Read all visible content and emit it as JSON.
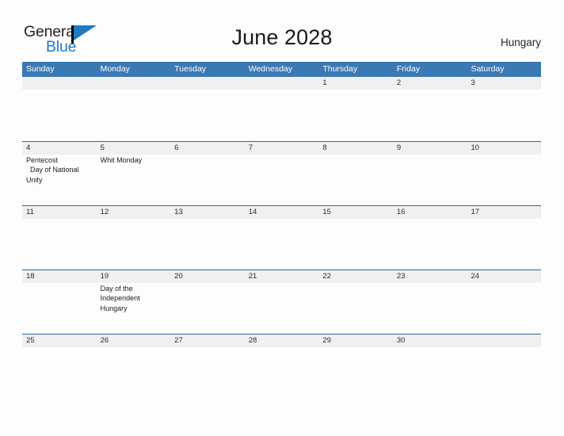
{
  "brand": {
    "word_one": "General",
    "word_two": "Blue",
    "flag_icon": "flag-triangle-icon"
  },
  "header": {
    "title": "June 2028",
    "country": "Hungary"
  },
  "colors": {
    "header_blue": "#3b79b5",
    "row_rule_blue": "#2b6598",
    "number_strip_gray": "#f0f0f0",
    "brand_blue": "#1f7ac4",
    "page_background": "#fdfdfd"
  },
  "calendar": {
    "weekdays": [
      "Sunday",
      "Monday",
      "Tuesday",
      "Wednesday",
      "Thursday",
      "Friday",
      "Saturday"
    ],
    "weeks": [
      [
        {
          "day": "",
          "events": []
        },
        {
          "day": "",
          "events": []
        },
        {
          "day": "",
          "events": []
        },
        {
          "day": "",
          "events": []
        },
        {
          "day": "1",
          "events": []
        },
        {
          "day": "2",
          "events": []
        },
        {
          "day": "3",
          "events": []
        }
      ],
      [
        {
          "day": "4",
          "events": [
            "Pentecost",
            "Day of National Unity"
          ]
        },
        {
          "day": "5",
          "events": [
            "Whit Monday"
          ]
        },
        {
          "day": "6",
          "events": []
        },
        {
          "day": "7",
          "events": []
        },
        {
          "day": "8",
          "events": []
        },
        {
          "day": "9",
          "events": []
        },
        {
          "day": "10",
          "events": []
        }
      ],
      [
        {
          "day": "11",
          "events": []
        },
        {
          "day": "12",
          "events": []
        },
        {
          "day": "13",
          "events": []
        },
        {
          "day": "14",
          "events": []
        },
        {
          "day": "15",
          "events": []
        },
        {
          "day": "16",
          "events": []
        },
        {
          "day": "17",
          "events": []
        }
      ],
      [
        {
          "day": "18",
          "events": []
        },
        {
          "day": "19",
          "events": [
            "Day of the Independent Hungary"
          ]
        },
        {
          "day": "20",
          "events": []
        },
        {
          "day": "21",
          "events": []
        },
        {
          "day": "22",
          "events": []
        },
        {
          "day": "23",
          "events": []
        },
        {
          "day": "24",
          "events": []
        }
      ],
      [
        {
          "day": "25",
          "events": []
        },
        {
          "day": "26",
          "events": []
        },
        {
          "day": "27",
          "events": []
        },
        {
          "day": "28",
          "events": []
        },
        {
          "day": "29",
          "events": []
        },
        {
          "day": "30",
          "events": []
        },
        {
          "day": "",
          "events": []
        }
      ]
    ]
  }
}
